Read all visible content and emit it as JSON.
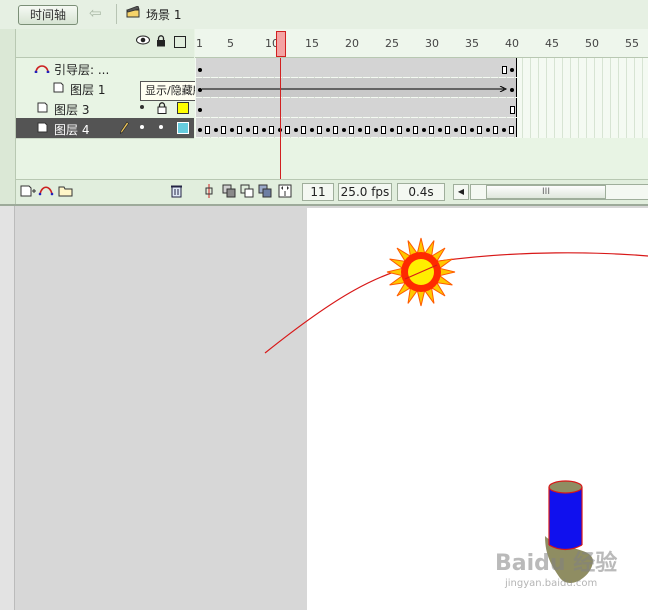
{
  "topbar": {
    "timeline_button": "时间轴",
    "scene": "场景 1"
  },
  "ruler": {
    "ticks": [
      "1",
      "5",
      "10",
      "15",
      "20",
      "25",
      "30",
      "35",
      "40",
      "45",
      "50",
      "55"
    ]
  },
  "layers": [
    {
      "name": "引导层: ...",
      "color": "#33cc33"
    },
    {
      "name": "图层 1",
      "color": "#33cc33"
    },
    {
      "name": "图层 3",
      "color": "#ffff00"
    },
    {
      "name": "图层 4",
      "color": "#66ccdd"
    }
  ],
  "tooltip": "显示/隐藏所有图层",
  "status": {
    "frame": "11",
    "fps": "25.0 fps",
    "time": "0.4s",
    "scroll_thumb": "III"
  },
  "stage": {
    "watermark": "Baidu 经验",
    "watermark_url": "jingyan.baidu.com"
  },
  "colors": {
    "sun_outer": "#ff2a00",
    "sun_inner": "#ffee00",
    "path": "#d81818",
    "cylinder": "#1010ee",
    "shadow": "#8f8d62"
  }
}
